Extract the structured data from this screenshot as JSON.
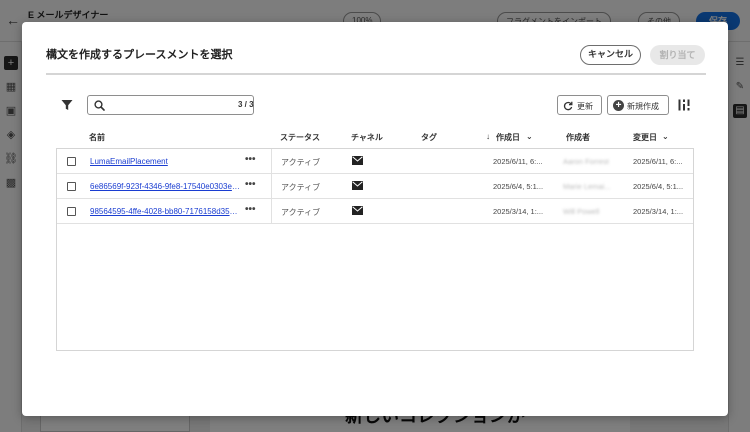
{
  "app": {
    "title": "E メールデザイナー",
    "toolbar_zoom": "100%",
    "toolbar_fragment": "フラグメントをインポート",
    "toolbar_more": "その他",
    "save_label": "保存",
    "canvas_text": "新しいコレクションが"
  },
  "modal": {
    "title": "構文を作成するプレースメントを選択",
    "cancel_label": "キャンセル",
    "assign_label": "割り当て",
    "search": {
      "placeholder": "",
      "value": ""
    },
    "result_count": "3 / 3",
    "refresh_label": "更新",
    "new_label": "新規作成",
    "columns": {
      "name": "名前",
      "status": "ステータス",
      "channel": "チャネル",
      "tags": "タグ",
      "created": "作成日",
      "author": "作成者",
      "modified": "変更日"
    },
    "rows": [
      {
        "name": "LumaEmailPlacement",
        "status": "アクティブ",
        "channel_icon": "email-icon",
        "tags": "",
        "created": "2025/6/11, 6:...",
        "author": "Aaron Forrest",
        "modified": "2025/6/11, 6:..."
      },
      {
        "name": "6e86569f-923f-4346-9fe8-17540e0303e8...",
        "status": "アクティブ",
        "channel_icon": "email-icon",
        "tags": "",
        "created": "2025/6/4, 5:1...",
        "author": "Marie Lemai...",
        "modified": "2025/6/4, 5:1..."
      },
      {
        "name": "98564595-4ffe-4028-bb80-7176158d3546...",
        "status": "アクティブ",
        "channel_icon": "email-icon",
        "tags": "",
        "created": "2025/3/14, 1:...",
        "author": "Will Powell",
        "modified": "2025/3/14, 1:..."
      }
    ]
  }
}
